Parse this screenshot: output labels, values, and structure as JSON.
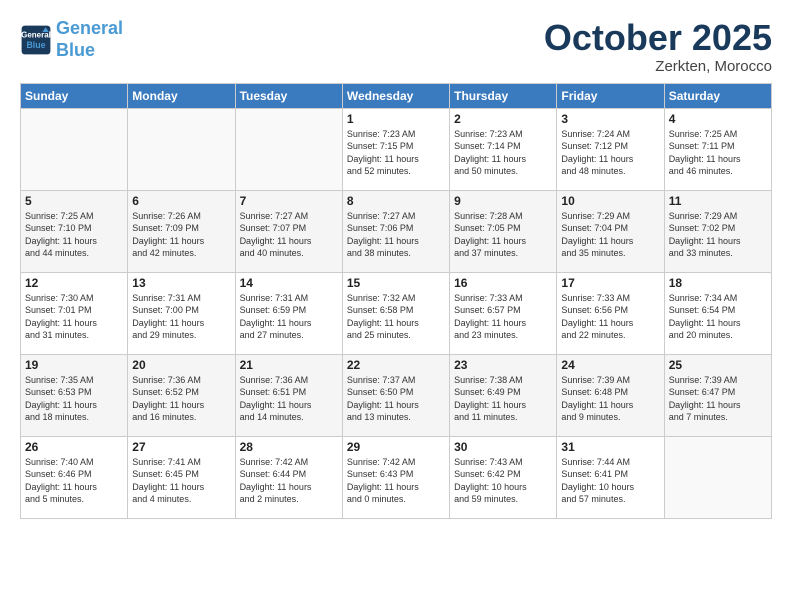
{
  "header": {
    "logo_line1": "General",
    "logo_line2": "Blue",
    "month": "October 2025",
    "location": "Zerkten, Morocco"
  },
  "weekdays": [
    "Sunday",
    "Monday",
    "Tuesday",
    "Wednesday",
    "Thursday",
    "Friday",
    "Saturday"
  ],
  "weeks": [
    [
      {
        "day": "",
        "info": ""
      },
      {
        "day": "",
        "info": ""
      },
      {
        "day": "",
        "info": ""
      },
      {
        "day": "1",
        "info": "Sunrise: 7:23 AM\nSunset: 7:15 PM\nDaylight: 11 hours\nand 52 minutes."
      },
      {
        "day": "2",
        "info": "Sunrise: 7:23 AM\nSunset: 7:14 PM\nDaylight: 11 hours\nand 50 minutes."
      },
      {
        "day": "3",
        "info": "Sunrise: 7:24 AM\nSunset: 7:12 PM\nDaylight: 11 hours\nand 48 minutes."
      },
      {
        "day": "4",
        "info": "Sunrise: 7:25 AM\nSunset: 7:11 PM\nDaylight: 11 hours\nand 46 minutes."
      }
    ],
    [
      {
        "day": "5",
        "info": "Sunrise: 7:25 AM\nSunset: 7:10 PM\nDaylight: 11 hours\nand 44 minutes."
      },
      {
        "day": "6",
        "info": "Sunrise: 7:26 AM\nSunset: 7:09 PM\nDaylight: 11 hours\nand 42 minutes."
      },
      {
        "day": "7",
        "info": "Sunrise: 7:27 AM\nSunset: 7:07 PM\nDaylight: 11 hours\nand 40 minutes."
      },
      {
        "day": "8",
        "info": "Sunrise: 7:27 AM\nSunset: 7:06 PM\nDaylight: 11 hours\nand 38 minutes."
      },
      {
        "day": "9",
        "info": "Sunrise: 7:28 AM\nSunset: 7:05 PM\nDaylight: 11 hours\nand 37 minutes."
      },
      {
        "day": "10",
        "info": "Sunrise: 7:29 AM\nSunset: 7:04 PM\nDaylight: 11 hours\nand 35 minutes."
      },
      {
        "day": "11",
        "info": "Sunrise: 7:29 AM\nSunset: 7:02 PM\nDaylight: 11 hours\nand 33 minutes."
      }
    ],
    [
      {
        "day": "12",
        "info": "Sunrise: 7:30 AM\nSunset: 7:01 PM\nDaylight: 11 hours\nand 31 minutes."
      },
      {
        "day": "13",
        "info": "Sunrise: 7:31 AM\nSunset: 7:00 PM\nDaylight: 11 hours\nand 29 minutes."
      },
      {
        "day": "14",
        "info": "Sunrise: 7:31 AM\nSunset: 6:59 PM\nDaylight: 11 hours\nand 27 minutes."
      },
      {
        "day": "15",
        "info": "Sunrise: 7:32 AM\nSunset: 6:58 PM\nDaylight: 11 hours\nand 25 minutes."
      },
      {
        "day": "16",
        "info": "Sunrise: 7:33 AM\nSunset: 6:57 PM\nDaylight: 11 hours\nand 23 minutes."
      },
      {
        "day": "17",
        "info": "Sunrise: 7:33 AM\nSunset: 6:56 PM\nDaylight: 11 hours\nand 22 minutes."
      },
      {
        "day": "18",
        "info": "Sunrise: 7:34 AM\nSunset: 6:54 PM\nDaylight: 11 hours\nand 20 minutes."
      }
    ],
    [
      {
        "day": "19",
        "info": "Sunrise: 7:35 AM\nSunset: 6:53 PM\nDaylight: 11 hours\nand 18 minutes."
      },
      {
        "day": "20",
        "info": "Sunrise: 7:36 AM\nSunset: 6:52 PM\nDaylight: 11 hours\nand 16 minutes."
      },
      {
        "day": "21",
        "info": "Sunrise: 7:36 AM\nSunset: 6:51 PM\nDaylight: 11 hours\nand 14 minutes."
      },
      {
        "day": "22",
        "info": "Sunrise: 7:37 AM\nSunset: 6:50 PM\nDaylight: 11 hours\nand 13 minutes."
      },
      {
        "day": "23",
        "info": "Sunrise: 7:38 AM\nSunset: 6:49 PM\nDaylight: 11 hours\nand 11 minutes."
      },
      {
        "day": "24",
        "info": "Sunrise: 7:39 AM\nSunset: 6:48 PM\nDaylight: 11 hours\nand 9 minutes."
      },
      {
        "day": "25",
        "info": "Sunrise: 7:39 AM\nSunset: 6:47 PM\nDaylight: 11 hours\nand 7 minutes."
      }
    ],
    [
      {
        "day": "26",
        "info": "Sunrise: 7:40 AM\nSunset: 6:46 PM\nDaylight: 11 hours\nand 5 minutes."
      },
      {
        "day": "27",
        "info": "Sunrise: 7:41 AM\nSunset: 6:45 PM\nDaylight: 11 hours\nand 4 minutes."
      },
      {
        "day": "28",
        "info": "Sunrise: 7:42 AM\nSunset: 6:44 PM\nDaylight: 11 hours\nand 2 minutes."
      },
      {
        "day": "29",
        "info": "Sunrise: 7:42 AM\nSunset: 6:43 PM\nDaylight: 11 hours\nand 0 minutes."
      },
      {
        "day": "30",
        "info": "Sunrise: 7:43 AM\nSunset: 6:42 PM\nDaylight: 10 hours\nand 59 minutes."
      },
      {
        "day": "31",
        "info": "Sunrise: 7:44 AM\nSunset: 6:41 PM\nDaylight: 10 hours\nand 57 minutes."
      },
      {
        "day": "",
        "info": ""
      }
    ]
  ]
}
